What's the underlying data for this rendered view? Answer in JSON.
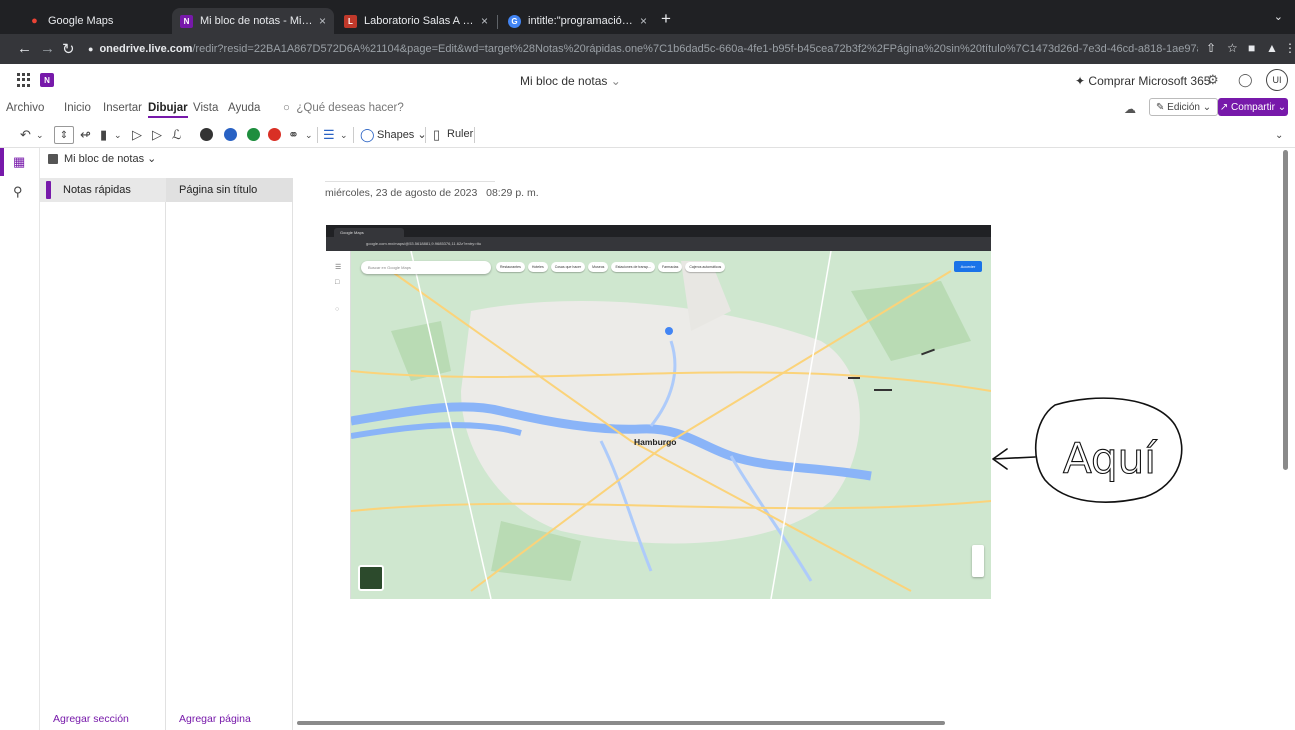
{
  "browser": {
    "tabs": [
      {
        "title": "Google Maps",
        "favicon": "maps-pin-icon",
        "color": "#ea4335"
      },
      {
        "title": "Mi bloc de notas - Microsoft On",
        "favicon": "onenote-icon",
        "color": "#7719aa"
      },
      {
        "title": "Laboratorio Salas A y B",
        "favicon": "lab-icon",
        "color": "#c0392b"
      },
      {
        "title": "intitle:\"programación en c\" inte",
        "favicon": "chrome-icon",
        "color": "#4285f4"
      }
    ],
    "url_host": "onedrive.live.com",
    "url_path": "/redir?resid=22BA1A867D572D6A%21104&page=Edit&wd=target%28Notas%20rápidas.one%7C1b6dad5c-660a-4fe1-b95f-b45cea72b3f2%2FPágina%20sin%20título%7C1473d26d-7e3d-46cd-a818-1ae97abc123f%2F%2..."
  },
  "header": {
    "notebook_title": "Mi bloc de notas",
    "buy_label": "Comprar Microsoft 365",
    "user_initials": "UI"
  },
  "ribbon": {
    "tabs": [
      "Archivo",
      "Inicio",
      "Insertar",
      "Dibujar",
      "Vista",
      "Ayuda"
    ],
    "active_tab": "Dibujar",
    "tell_me": "¿Qué deseas hacer?",
    "edit_mode": "Edición",
    "share": "Compartir"
  },
  "draw_toolbar": {
    "shapes_label": "Shapes",
    "ruler_label": "Ruler",
    "pen_colors": [
      "#333333",
      "#2962c4",
      "#1e8e3e",
      "#d93025"
    ]
  },
  "navigation": {
    "notebook_picker": "Mi bloc de notas",
    "section": "Notas rápidas",
    "section_color": "#7719aa",
    "page": "Página sin título",
    "add_section": "Agregar sección",
    "add_page": "Agregar página"
  },
  "page": {
    "date": "miércoles, 23 de agosto de 2023",
    "time": "08:29 p. m."
  },
  "embedded_screenshot": {
    "tab_title": "Google Maps",
    "omnibox": "google.com.mx/maps/@53.5618881,9.9685376,11.62z?entry=ttu",
    "search_placeholder": "Buscar en Google Maps",
    "chips": [
      "Restaurantes",
      "Hoteles",
      "Cosas que hacer",
      "Museos",
      "Estaciones de transp...",
      "Farmacias",
      "Cajeros automáticos"
    ],
    "sign_in": "Acceder",
    "city_label": "Hamburgo"
  },
  "annotation": {
    "handwritten_text": "Aquí"
  }
}
